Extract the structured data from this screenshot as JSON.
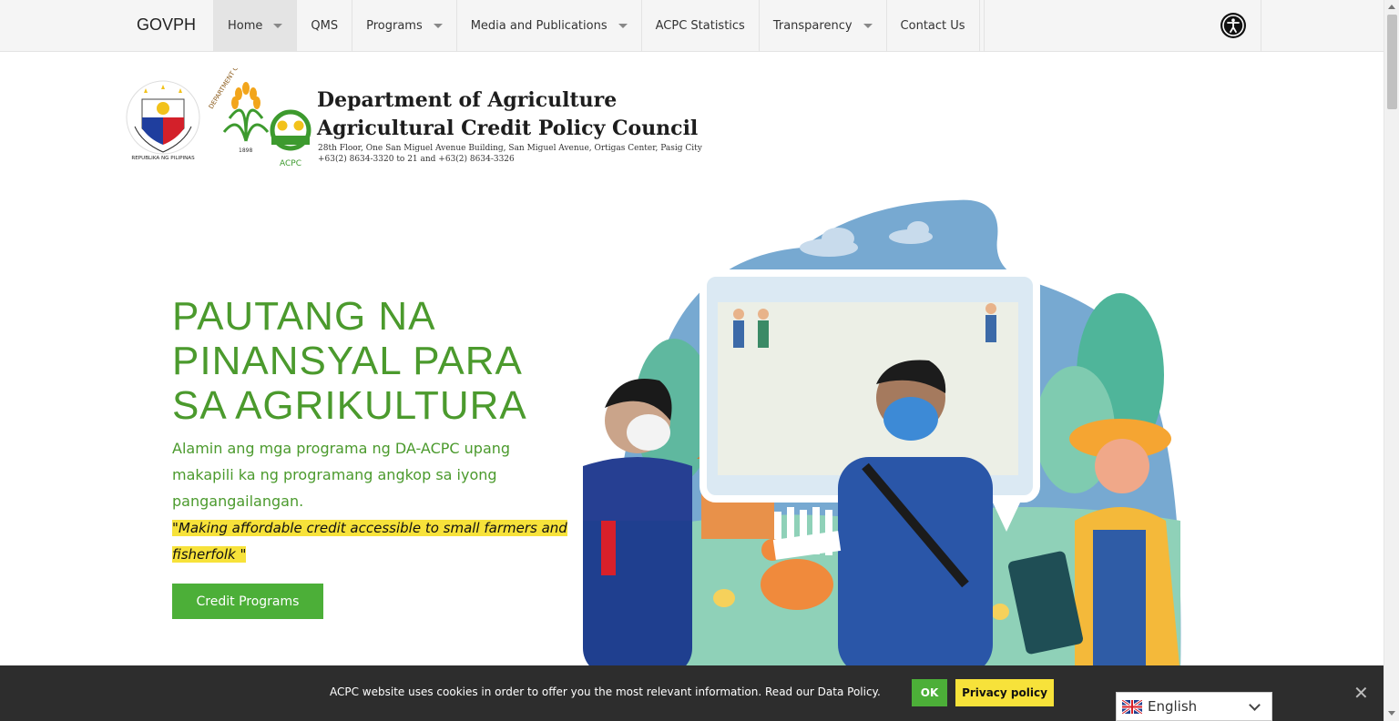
{
  "nav": {
    "brand": "GOVPH",
    "items": [
      {
        "label": "Home",
        "dropdown": true,
        "active": true
      },
      {
        "label": "QMS",
        "dropdown": false
      },
      {
        "label": "Programs",
        "dropdown": true
      },
      {
        "label": "Media and Publications",
        "dropdown": true
      },
      {
        "label": "ACPC Statistics",
        "dropdown": false
      },
      {
        "label": "Transparency",
        "dropdown": true
      },
      {
        "label": "Contact Us",
        "dropdown": false
      }
    ],
    "accessibility_icon": "accessibility-icon"
  },
  "header": {
    "org_line1": "Department of Agriculture",
    "org_line2": "Agricultural Credit Policy Council",
    "address_line1": "28th Floor, One San Miguel Avenue Building, San Miguel Avenue, Ortigas Center, Pasig City",
    "address_line2": "+63(2) 8634-3320 to 21 and +63(2) 8634-3326",
    "seal_text": "REPUBLIKA NG PILIPINAS",
    "da_logo_text": "DEPARTMENT OF AGRICULTURE",
    "da_logo_year": "1898",
    "acpc_logo_text": "ACPC"
  },
  "hero": {
    "title_lines": [
      "PAUTANG NA",
      "PINANSYAL PARA",
      "SA AGRIKULTURA"
    ],
    "subtitle": "Alamin ang mga programa ng DA-ACPC upang makapili ka ng programang angkop sa iyong pangangailangan.",
    "quote": "\"Making affordable credit accessible to small farmers and fisherfolk \"",
    "cta_label": "Credit Programs"
  },
  "cookie": {
    "text": "ACPC website uses cookies in order to offer you the most relevant information. Read our Data Policy.",
    "ok_label": "OK",
    "privacy_label": "Privacy policy"
  },
  "language": {
    "selected": "English",
    "flag_icon": "uk-flag-icon"
  },
  "colors": {
    "brand_green": "#4b9a2d",
    "button_green": "#4caf38",
    "highlight_yellow": "#f7e23a",
    "cookie_bg": "#2d2d2d"
  }
}
